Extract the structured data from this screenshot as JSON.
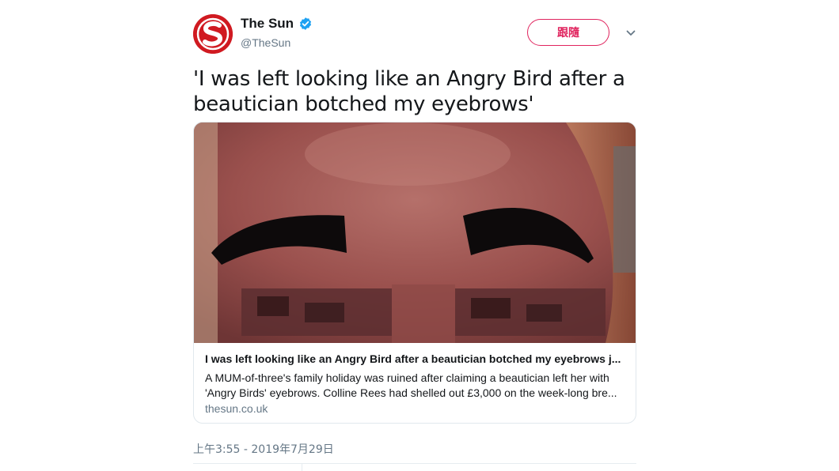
{
  "account": {
    "name": "The Sun",
    "handle": "@TheSun",
    "avatar_letter": "S",
    "verified_icon": "verified-badge-icon"
  },
  "follow_button": {
    "label": "跟隨"
  },
  "menu_icon": "chevron-down-icon",
  "tweet": {
    "text": "'I was left looking like an Angry Bird after a beautician botched my eyebrows'"
  },
  "card": {
    "image_icon": "photo-face-eyebrows",
    "title": "I was left looking like an Angry Bird after a beautician botched my eyebrows j...",
    "description_line1": "A MUM-of-three's family holiday was ruined after claiming a beautician left her with",
    "description_line2": "'Angry Birds' eyebrows. Colline Rees had shelled out £3,000 on the week-long bre...",
    "domain": "thesun.co.uk"
  },
  "timestamp": "上午3:55 - 2019年7月29日",
  "colors": {
    "brand_red": "#d01a21",
    "follow_pink": "#e0245e",
    "verified_blue": "#1da1f2",
    "muted": "#657786"
  }
}
